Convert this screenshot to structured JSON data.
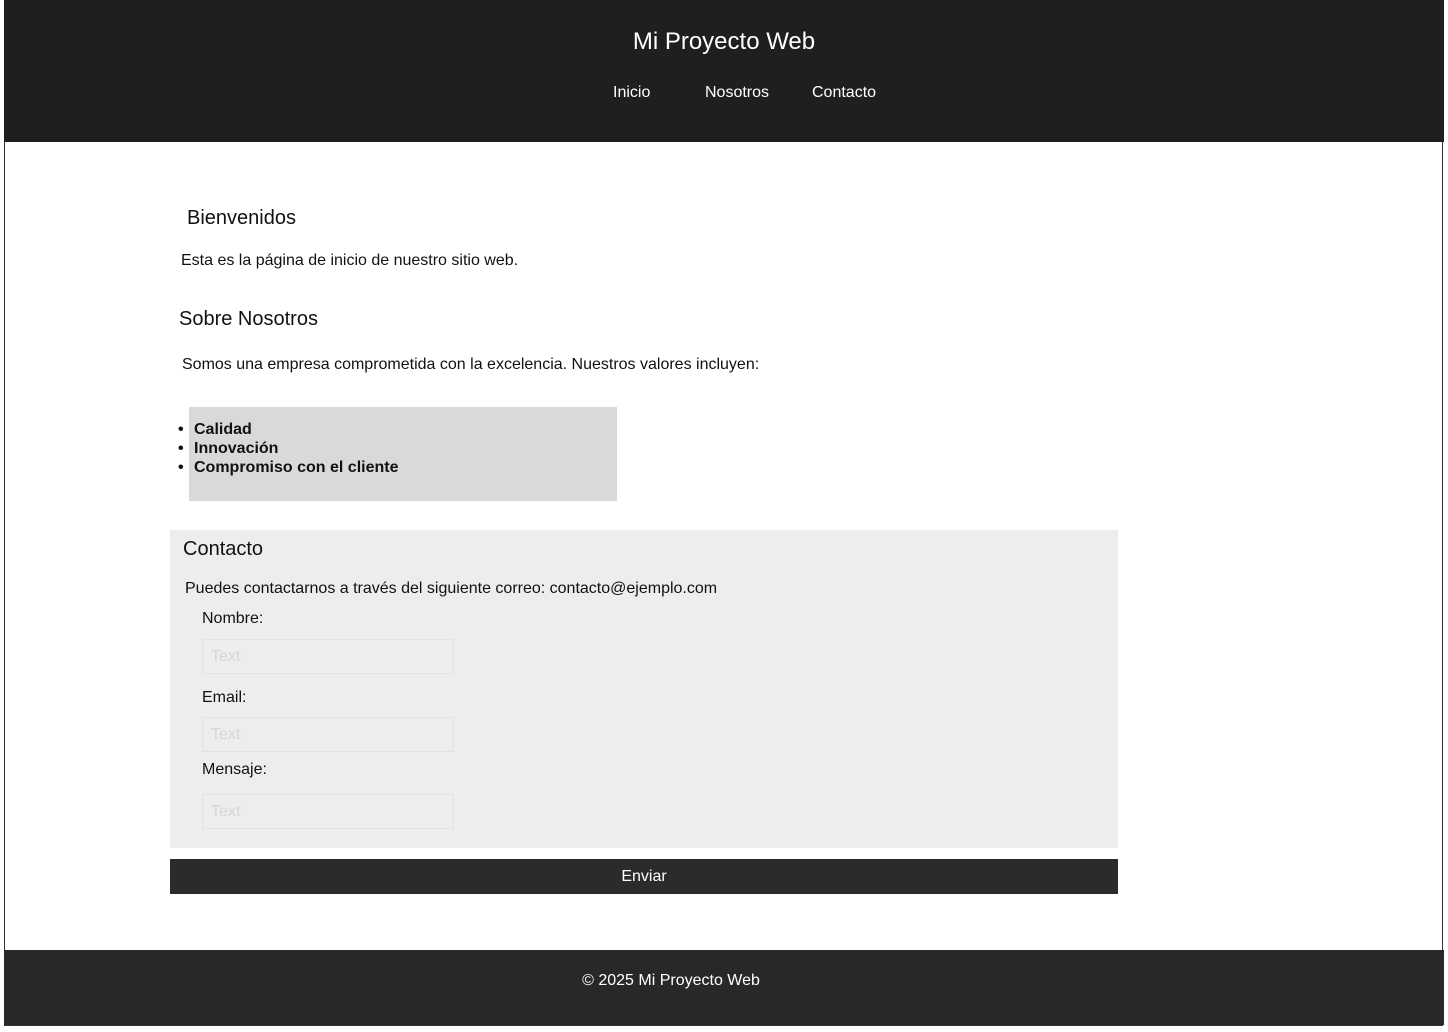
{
  "header": {
    "site_title": "Mi Proyecto Web",
    "nav": [
      "Inicio",
      "Nosotros",
      "Contacto"
    ]
  },
  "welcome": {
    "heading": "Bienvenidos",
    "text": "Esta es la página de inicio de nuestro sitio web."
  },
  "about": {
    "heading": "Sobre Nosotros",
    "text": "Somos una empresa comprometida con la excelencia. Nuestros valores incluyen:",
    "values": [
      "Calidad",
      "Innovación",
      "Compromiso con el cliente"
    ]
  },
  "contact": {
    "heading": "Contacto",
    "text": "Puedes contactarnos a través del siguiente correo: contacto@ejemplo.com",
    "name_label": "Nombre:",
    "name_placeholder": "Text",
    "email_label": "Email:",
    "email_placeholder": "Text",
    "message_label": "Mensaje:",
    "message_placeholder": "Text",
    "submit_label": "Enviar"
  },
  "footer": {
    "text": "© 2025 Mi Proyecto Web"
  }
}
